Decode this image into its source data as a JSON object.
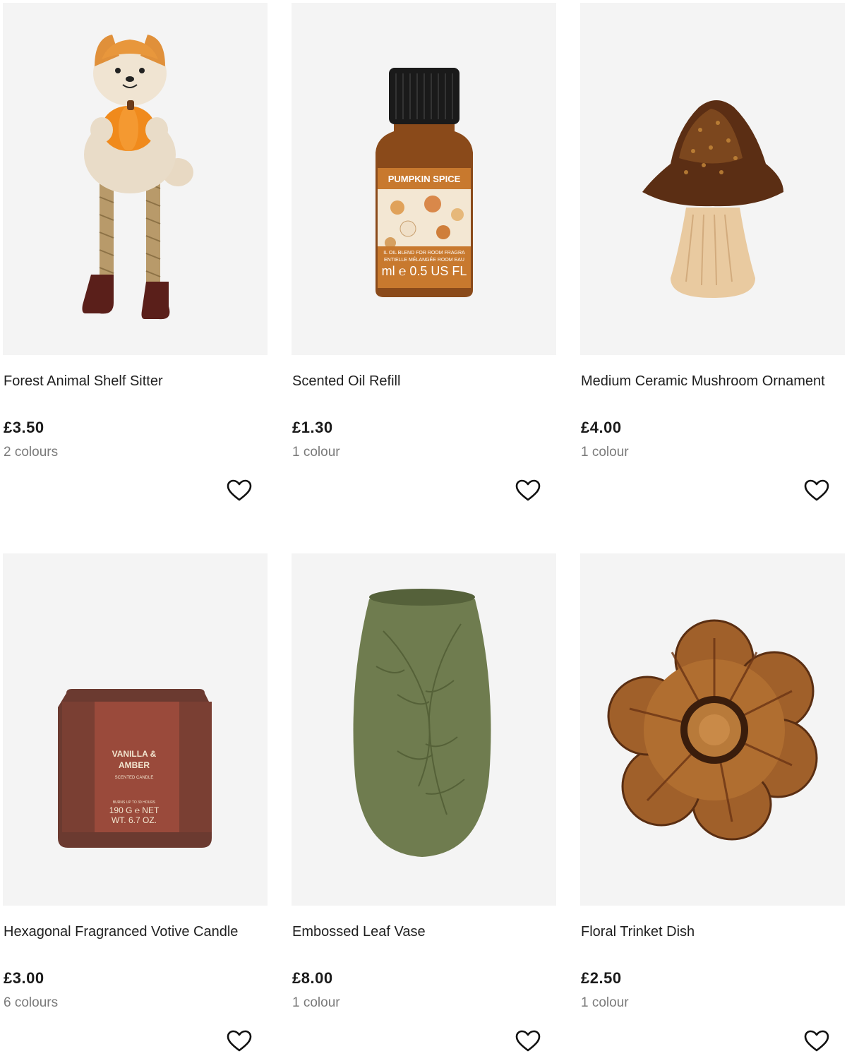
{
  "products": [
    {
      "name": "Forest Animal Shelf Sitter",
      "price": "£3.50",
      "colours": "2 colours",
      "icon": "heart-outline-icon"
    },
    {
      "name": "Scented Oil Refill",
      "price": "£1.30",
      "colours": "1 colour",
      "label_line1": "PUMPKIN SPICE",
      "label_line2": "IL OIL BLEND FOR ROOM FRAGRA",
      "label_line3": "ENTIELLE MÉLANGÉE ROOM EAU",
      "label_line4": "ml ℮ 0.5 US FL",
      "icon": "heart-outline-icon"
    },
    {
      "name": "Medium Ceramic Mushroom Ornament",
      "price": "£4.00",
      "colours": "1 colour",
      "icon": "heart-outline-icon"
    },
    {
      "name": "Hexagonal Fragranced Votive Candle",
      "price": "£3.00",
      "colours": "6 colours",
      "label_line1": "VANILLA &",
      "label_line2": "AMBER",
      "label_line3": "SCENTED CANDLE",
      "label_line4": "BURNS UP TO 30 HOURS",
      "label_line5": "190 G ℮ NET",
      "label_line6": "WT. 6.7 OZ.",
      "icon": "heart-outline-icon"
    },
    {
      "name": "Embossed Leaf Vase",
      "price": "£8.00",
      "colours": "1 colour",
      "icon": "heart-outline-icon"
    },
    {
      "name": "Floral Trinket Dish",
      "price": "£2.50",
      "colours": "1 colour",
      "icon": "heart-outline-icon"
    }
  ],
  "colors": {
    "image_bg": "#f4f4f4",
    "price": "#1a1a1a",
    "muted": "#7a7a7a"
  }
}
